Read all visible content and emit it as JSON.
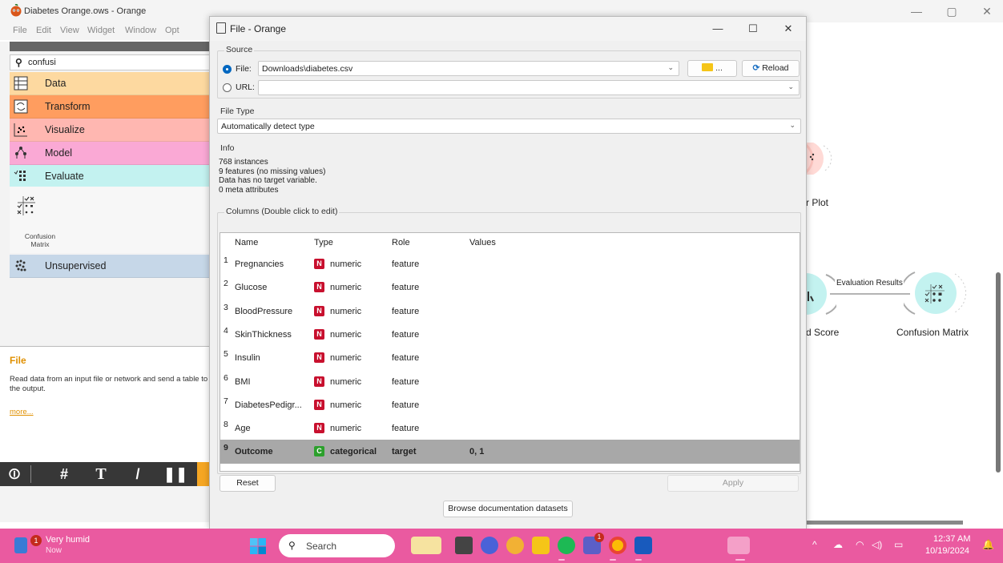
{
  "main_window": {
    "title": "Diabetes Orange.ows - Orange",
    "menu": [
      "File",
      "Edit",
      "View",
      "Widget",
      "Window",
      "Opt"
    ]
  },
  "toolbox": {
    "search_value": "confusi",
    "categories": [
      {
        "label": "Data",
        "color": "#fdd9a0"
      },
      {
        "label": "Transform",
        "color": "#ff9d5f"
      },
      {
        "label": "Visualize",
        "color": "#ffb7b1"
      },
      {
        "label": "Model",
        "color": "#faa9d5"
      },
      {
        "label": "Evaluate",
        "color": "#c3f2f0"
      },
      {
        "label": "Unsupervised",
        "color": "#c6d7e8"
      }
    ],
    "widget_label": "Confusion Matrix",
    "widget_label_line1": "Confusion",
    "widget_label_line2": "Matrix"
  },
  "help": {
    "title": "File",
    "text": "Read data from an input file or network and send a table to the output.",
    "more": "more..."
  },
  "canvas": {
    "scatter_label": "r Plot",
    "score_label": "d Score",
    "confusion_label": "Confusion Matrix",
    "link_label": "Evaluation Results"
  },
  "dialog": {
    "title": "File - Orange",
    "source": {
      "title": "Source",
      "file_label": "File:",
      "file_value": "Downloads\\diabetes.csv",
      "browse_label": "...",
      "reload_label": "Reload",
      "url_label": "URL:",
      "url_value": ""
    },
    "file_type": {
      "title": "File Type",
      "value": "Automatically detect type"
    },
    "info": {
      "title": "Info",
      "line1": "768 instances",
      "line2": "9 features (no missing values)",
      "line3": "Data has no target variable.",
      "line4": "0 meta attributes"
    },
    "columns": {
      "title": "Columns (Double click to edit)",
      "headers": [
        "Name",
        "Type",
        "Role",
        "Values"
      ],
      "rows": [
        {
          "num": "1",
          "name": "Pregnancies",
          "badge": "N",
          "type": "numeric",
          "role": "feature",
          "values": ""
        },
        {
          "num": "2",
          "name": "Glucose",
          "badge": "N",
          "type": "numeric",
          "role": "feature",
          "values": ""
        },
        {
          "num": "3",
          "name": "BloodPressure",
          "badge": "N",
          "type": "numeric",
          "role": "feature",
          "values": ""
        },
        {
          "num": "4",
          "name": "SkinThickness",
          "badge": "N",
          "type": "numeric",
          "role": "feature",
          "values": ""
        },
        {
          "num": "5",
          "name": "Insulin",
          "badge": "N",
          "type": "numeric",
          "role": "feature",
          "values": ""
        },
        {
          "num": "6",
          "name": "BMI",
          "badge": "N",
          "type": "numeric",
          "role": "feature",
          "values": ""
        },
        {
          "num": "7",
          "name": "DiabetesPedigr...",
          "badge": "N",
          "type": "numeric",
          "role": "feature",
          "values": ""
        },
        {
          "num": "8",
          "name": "Age",
          "badge": "N",
          "type": "numeric",
          "role": "feature",
          "values": ""
        },
        {
          "num": "9",
          "name": "Outcome",
          "badge": "C",
          "type": "categorical",
          "role": "target",
          "values": "0, 1"
        }
      ]
    },
    "reset_label": "Reset",
    "apply_label": "Apply",
    "browse_docs_label": "Browse documentation datasets"
  },
  "taskbar": {
    "weather_title": "Very humid",
    "weather_sub": "Now",
    "weather_badge": "1",
    "search_label": "Search",
    "time": "12:37 AM",
    "date": "10/19/2024",
    "colors": {
      "bar": "#ea5aa0"
    }
  }
}
